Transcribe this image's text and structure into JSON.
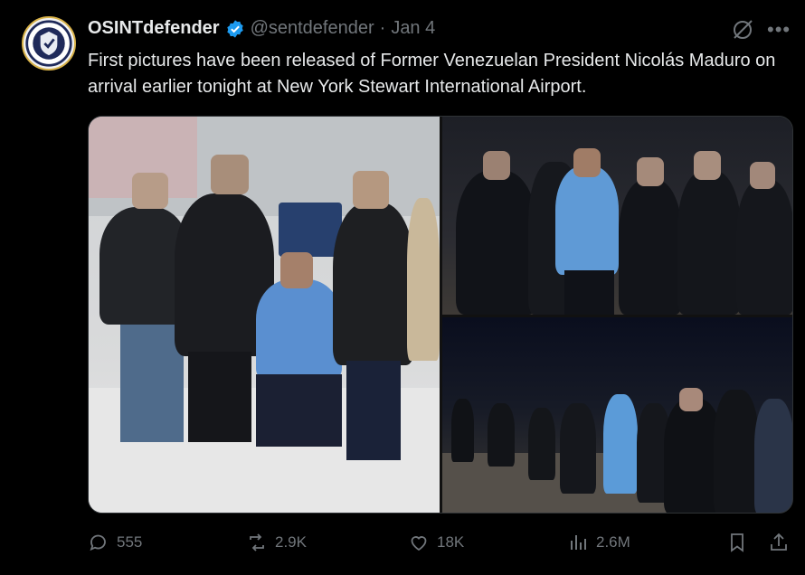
{
  "post": {
    "display_name": "OSINTdefender",
    "handle": "@sentdefender",
    "separator": "·",
    "date": "Jan 4",
    "text": "First pictures have been released of Former Venezuelan President Nicolás Maduro on arrival earlier tonight at New York Stewart International Airport."
  },
  "icons": {
    "verified": "verified-badge-icon",
    "grok": "grok-icon",
    "more": "more-icon",
    "reply": "reply-icon",
    "repost": "repost-icon",
    "like": "like-icon",
    "views": "views-icon",
    "bookmark": "bookmark-icon",
    "share": "share-icon"
  },
  "actions": {
    "replies": "555",
    "reposts": "2.9K",
    "likes": "18K",
    "views": "2.6M"
  },
  "media": {
    "photo_count": 3
  },
  "colors": {
    "background": "#000000",
    "text": "#e7e9ea",
    "muted": "#71767b",
    "verified": "#1d9bf0"
  }
}
